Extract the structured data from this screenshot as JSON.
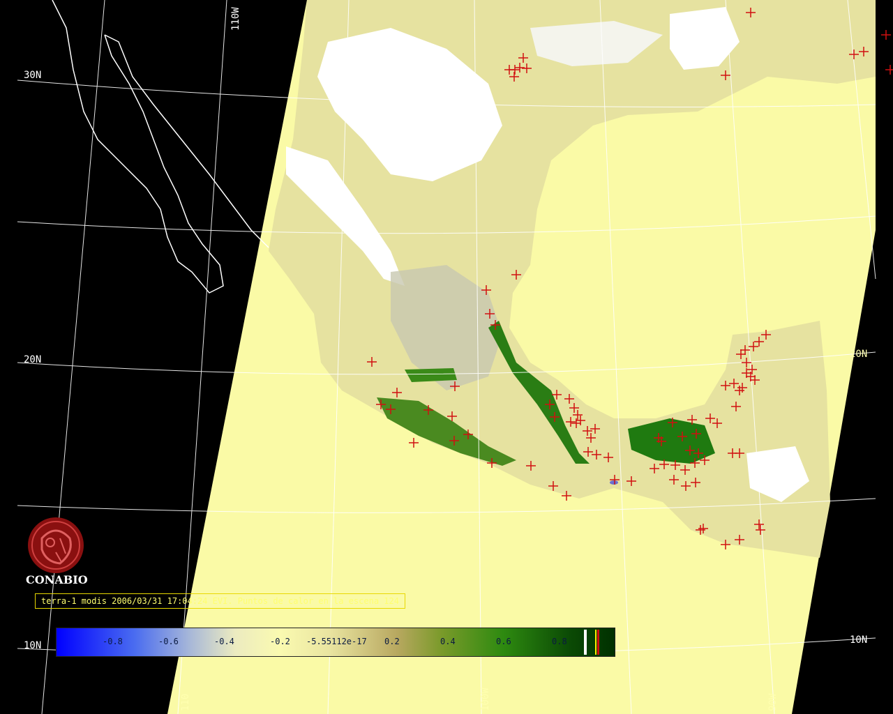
{
  "grid_labels": {
    "lat_30": "30N",
    "lat_20": "20N",
    "lat_20_right": "20N",
    "lat_10": "10N",
    "lat_10_right": "10N",
    "lon_110": "110W",
    "lon_100_bottom": "100W",
    "lon_110_bottom": "110",
    "lon_90_bottom": "90W"
  },
  "logo": {
    "name": "CONABIO",
    "icon": "conabio-seal-icon"
  },
  "caption": "terra-1 modis 2006/03/31 17:04:24 EVI. Puntos de calor en la escena 124",
  "colorbar": {
    "ticks": [
      "-0.8",
      "-0.6",
      "-0.4",
      "-0.2",
      "-5.55112e-17",
      "0.2",
      "0.4",
      "0.6",
      "0.8"
    ],
    "min": -1.0,
    "max": 1.0
  },
  "hotspots": {
    "count": 124,
    "marker_color": "#d01010",
    "marker": "plus-icon"
  },
  "colors": {
    "background": "#000000",
    "ocean_swath": "#fafaa6",
    "cloud": "#ffffff",
    "vegetation_dense": "#1f7a10",
    "coastline": "#ffffff",
    "caption_border": "#e8d800"
  }
}
